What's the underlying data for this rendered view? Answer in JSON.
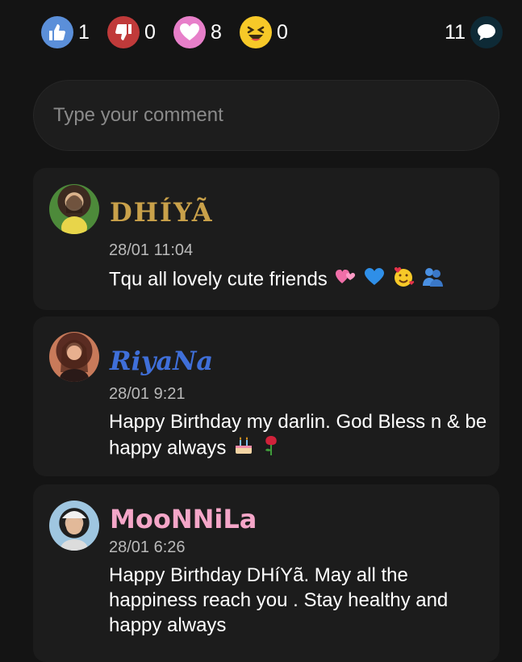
{
  "reactions": [
    {
      "name": "like",
      "count": "1",
      "color": "#5b8fd9"
    },
    {
      "name": "dislike",
      "count": "0",
      "color": "#c03a3a"
    },
    {
      "name": "love",
      "count": "8",
      "color": "#e77fc9"
    },
    {
      "name": "haha",
      "count": "0",
      "color": "#f7c928"
    }
  ],
  "comment_count": "11",
  "comment_input": {
    "placeholder": "Type your comment"
  },
  "comments": [
    {
      "username": "DHÍYÃ",
      "timestamp": "28/01 11:04",
      "text": "Tqu all lovely cute friends",
      "emojis": [
        "two-hearts-icon",
        "blue-heart-icon",
        "smiling-face-with-hearts-icon",
        "people-hugging-icon"
      ]
    },
    {
      "username": "RiyaNa",
      "timestamp": "28/01 9:21",
      "text": "Happy Birthday my darlin. God Bless n & be happy always",
      "emojis": [
        "birthday-cake-icon",
        "rose-icon"
      ]
    },
    {
      "username": "MooNNiLa",
      "timestamp": "28/01 6:26",
      "text": "Happy Birthday DHíYã. May all the happiness reach you . Stay healthy and happy always",
      "emojis": []
    }
  ],
  "colors": {
    "background": "#141414",
    "card": "#1c1c1c",
    "username_riyana": "#3f6fd9",
    "username_moonnila": "#f4a6c8",
    "username_dhiya": "#c9a14a"
  }
}
